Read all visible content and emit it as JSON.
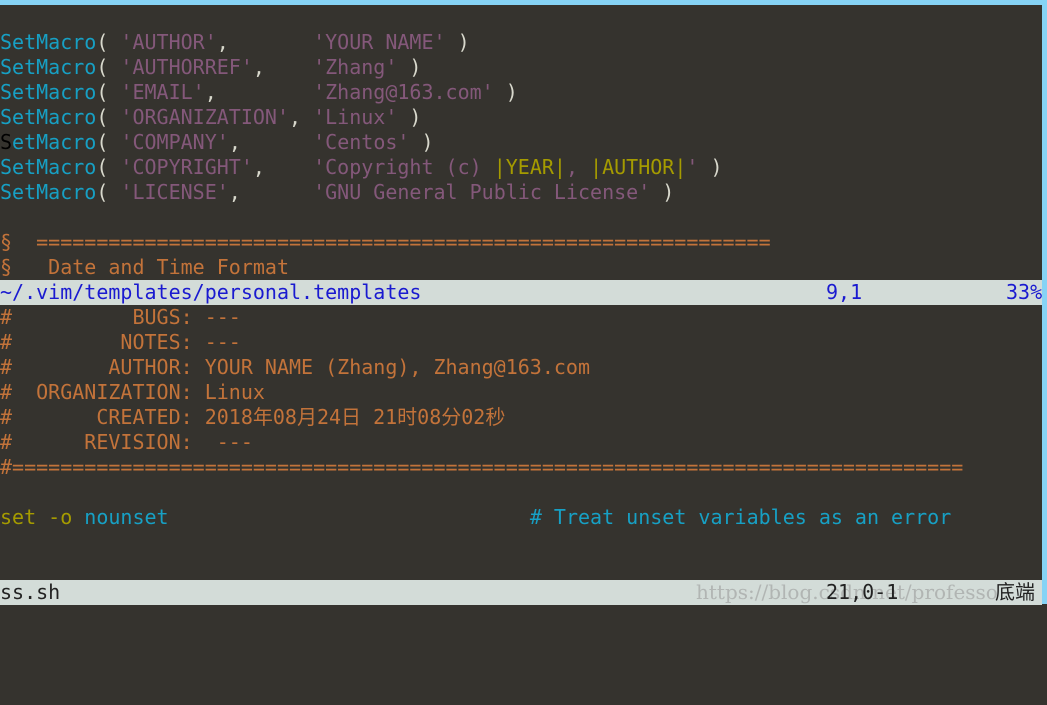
{
  "colors": {
    "background": "#35332e",
    "function": "#17a0c4",
    "string": "#84587a",
    "special": "#a59b00",
    "comment": "#c3733a",
    "statusbar": "#d3dcd8",
    "status_text_active": "#1a1ad0",
    "cursor": "#1cf01c"
  },
  "upper_pane": {
    "lines": [
      [
        {
          "t": "SetMacro",
          "c": "func"
        },
        {
          "t": "( ",
          "c": "punct"
        },
        {
          "t": "'AUTHOR'",
          "c": "str"
        },
        {
          "t": ",       ",
          "c": "punct"
        },
        {
          "t": "'YOUR NAME'",
          "c": "str"
        },
        {
          "t": " )",
          "c": "punct"
        }
      ],
      [
        {
          "t": "SetMacro",
          "c": "func"
        },
        {
          "t": "( ",
          "c": "punct"
        },
        {
          "t": "'AUTHORREF'",
          "c": "str"
        },
        {
          "t": ",    ",
          "c": "punct"
        },
        {
          "t": "'Zhang'",
          "c": "str"
        },
        {
          "t": " )",
          "c": "punct"
        }
      ],
      [
        {
          "t": "SetMacro",
          "c": "func"
        },
        {
          "t": "( ",
          "c": "punct"
        },
        {
          "t": "'EMAIL'",
          "c": "str"
        },
        {
          "t": ",        ",
          "c": "punct"
        },
        {
          "t": "'Zhang@163.com'",
          "c": "str"
        },
        {
          "t": " )",
          "c": "punct"
        }
      ],
      [
        {
          "t": "SetMacro",
          "c": "func"
        },
        {
          "t": "( ",
          "c": "punct"
        },
        {
          "t": "'ORGANIZATION'",
          "c": "str"
        },
        {
          "t": ", ",
          "c": "punct"
        },
        {
          "t": "'Linux'",
          "c": "str"
        },
        {
          "t": " )",
          "c": "punct"
        }
      ],
      [
        {
          "t": "S",
          "c": "cursor"
        },
        {
          "t": "etMacro",
          "c": "func"
        },
        {
          "t": "( ",
          "c": "punct"
        },
        {
          "t": "'COMPANY'",
          "c": "str"
        },
        {
          "t": ",      ",
          "c": "punct"
        },
        {
          "t": "'Centos'",
          "c": "str"
        },
        {
          "t": " )",
          "c": "punct"
        }
      ],
      [
        {
          "t": "SetMacro",
          "c": "func"
        },
        {
          "t": "( ",
          "c": "punct"
        },
        {
          "t": "'COPYRIGHT'",
          "c": "str"
        },
        {
          "t": ",    ",
          "c": "punct"
        },
        {
          "t": "'Copyright (c) ",
          "c": "str"
        },
        {
          "t": "|YEAR|",
          "c": "special"
        },
        {
          "t": ", ",
          "c": "str"
        },
        {
          "t": "|AUTHOR|",
          "c": "special"
        },
        {
          "t": "'",
          "c": "str"
        },
        {
          "t": " )",
          "c": "punct"
        }
      ],
      [
        {
          "t": "SetMacro",
          "c": "func"
        },
        {
          "t": "( ",
          "c": "punct"
        },
        {
          "t": "'LICENSE'",
          "c": "str"
        },
        {
          "t": ",      ",
          "c": "punct"
        },
        {
          "t": "'GNU General Public License'",
          "c": "str"
        },
        {
          "t": " )",
          "c": "punct"
        }
      ],
      [],
      [
        {
          "t": "§  =============================================================",
          "c": "comment"
        }
      ],
      [
        {
          "t": "§   Date and Time Format",
          "c": "comment"
        }
      ]
    ],
    "status": {
      "filename": "~/.vim/templates/personal.templates",
      "position": "9,1",
      "percent": "33%"
    }
  },
  "lower_pane": {
    "lines": [
      [
        {
          "t": "#          BUGS: ---",
          "c": "comment"
        }
      ],
      [
        {
          "t": "#         NOTES: ---",
          "c": "comment"
        }
      ],
      [
        {
          "t": "#        AUTHOR: YOUR NAME (Zhang), Zhang@163.com",
          "c": "comment"
        }
      ],
      [
        {
          "t": "#  ORGANIZATION: Linux",
          "c": "comment"
        }
      ],
      [
        {
          "t": "#       CREATED: 2018年08月24日 21时08分02秒",
          "c": "comment"
        }
      ],
      [
        {
          "t": "#      REVISION:  ---",
          "c": "comment"
        }
      ],
      [
        {
          "t": "#===============================================================================",
          "c": "comment"
        }
      ],
      [],
      [
        {
          "t": "set -o",
          "c": "kw"
        },
        {
          "t": " ",
          "c": "punct"
        },
        {
          "t": "nounset",
          "c": "cyan"
        },
        {
          "t": "                              ",
          "c": "punct"
        },
        {
          "t": "# Treat unset variables as an error",
          "c": "cyan"
        }
      ],
      [],
      []
    ],
    "status": {
      "filename": "ss.sh",
      "position": "21,0-1",
      "scroll": "底端"
    }
  },
  "watermark": "https://blog.csdn.net/professo"
}
